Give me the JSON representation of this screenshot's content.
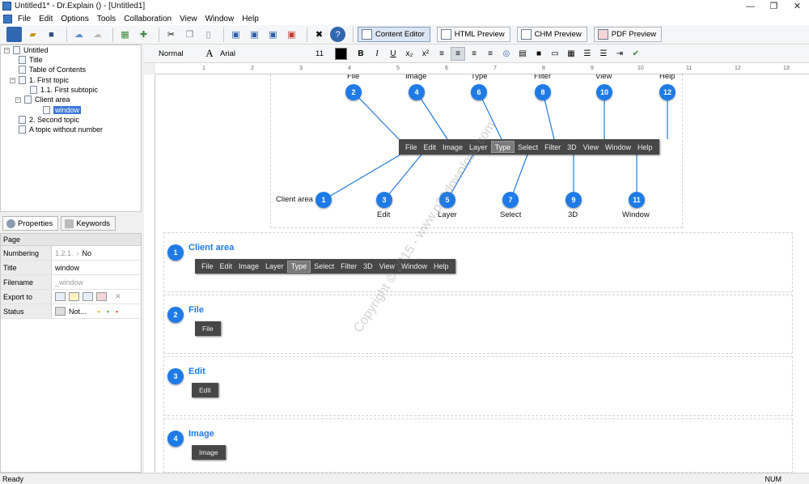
{
  "window": {
    "title": "Untitled1* - Dr.Explain () - [Untitled1]",
    "controls": [
      "—",
      "❐",
      "✕"
    ]
  },
  "menu": [
    "File",
    "Edit",
    "Options",
    "Tools",
    "Collaboration",
    "View",
    "Window",
    "Help"
  ],
  "mode_buttons": [
    {
      "label": "Content Editor",
      "active": true
    },
    {
      "label": "HTML Preview",
      "active": false
    },
    {
      "label": "CHM Preview",
      "active": false
    },
    {
      "label": "PDF Preview",
      "active": false
    }
  ],
  "tree": [
    {
      "label": "Untitled",
      "level": 0,
      "expandable": true
    },
    {
      "label": "Title",
      "level": 1
    },
    {
      "label": "Table of Contents",
      "level": 1
    },
    {
      "label": "1. First topic",
      "level": 1,
      "expandable": true
    },
    {
      "label": "1.1. First subtopic",
      "level": 2
    },
    {
      "label": "Client area",
      "level": 2,
      "expandable": true
    },
    {
      "label": "window",
      "level": 3,
      "selected": true
    },
    {
      "label": "2. Second topic",
      "level": 1
    },
    {
      "label": "A topic without number",
      "level": 1
    }
  ],
  "prop_tabs": [
    {
      "label": "Properties",
      "active": true
    },
    {
      "label": "Keywords",
      "active": false
    }
  ],
  "prop_grid": {
    "header": "Page",
    "rows": [
      {
        "key": "Numbering",
        "value_grey": "1.2.1.",
        "value": "No"
      },
      {
        "key": "Title",
        "value": "window"
      },
      {
        "key": "Filename",
        "value_grey": "_window"
      },
      {
        "key": "Export to",
        "value": ""
      },
      {
        "key": "Status",
        "value": "Not..."
      }
    ]
  },
  "format": {
    "style": "Normal",
    "font": "Arial",
    "size": "11",
    "color": "#000000"
  },
  "ruler_marks": [
    "1",
    "2",
    "3",
    "4",
    "5",
    "6",
    "7",
    "8",
    "9",
    "10",
    "11",
    "12",
    "13"
  ],
  "diagram": {
    "menu_items": [
      {
        "label": "File",
        "selected": false
      },
      {
        "label": "Edit",
        "selected": false
      },
      {
        "label": "Image",
        "selected": false
      },
      {
        "label": "Layer",
        "selected": false
      },
      {
        "label": "Type",
        "selected": true
      },
      {
        "label": "Select",
        "selected": false
      },
      {
        "label": "Filter",
        "selected": false
      },
      {
        "label": "3D",
        "selected": false
      },
      {
        "label": "View",
        "selected": false
      },
      {
        "label": "Window",
        "selected": false
      },
      {
        "label": "Help",
        "selected": false
      }
    ],
    "top_labels": [
      "File",
      "Image",
      "Type",
      "Filter",
      "View",
      "Help"
    ],
    "top_badges": [
      "2",
      "4",
      "6",
      "8",
      "10",
      "12"
    ],
    "bottom_badges": [
      "1",
      "3",
      "5",
      "7",
      "9",
      "11"
    ],
    "bottom_labels": [
      "Edit",
      "Layer",
      "Select",
      "3D",
      "Window"
    ],
    "client_area_label": "Client area"
  },
  "sections": [
    {
      "num": "1",
      "title": "Client area",
      "button": null
    },
    {
      "num": "2",
      "title": "File",
      "button": "File"
    },
    {
      "num": "3",
      "title": "Edit",
      "button": "Edit"
    },
    {
      "num": "4",
      "title": "Image",
      "button": "Image"
    }
  ],
  "status": {
    "left": "Ready",
    "right": "NUM"
  },
  "watermark": "Copyright © 2015 - www.p30download.com",
  "colors": {
    "badge": "#1e7be6",
    "dark_menu": "#474747",
    "selection": "#3b78d7"
  }
}
